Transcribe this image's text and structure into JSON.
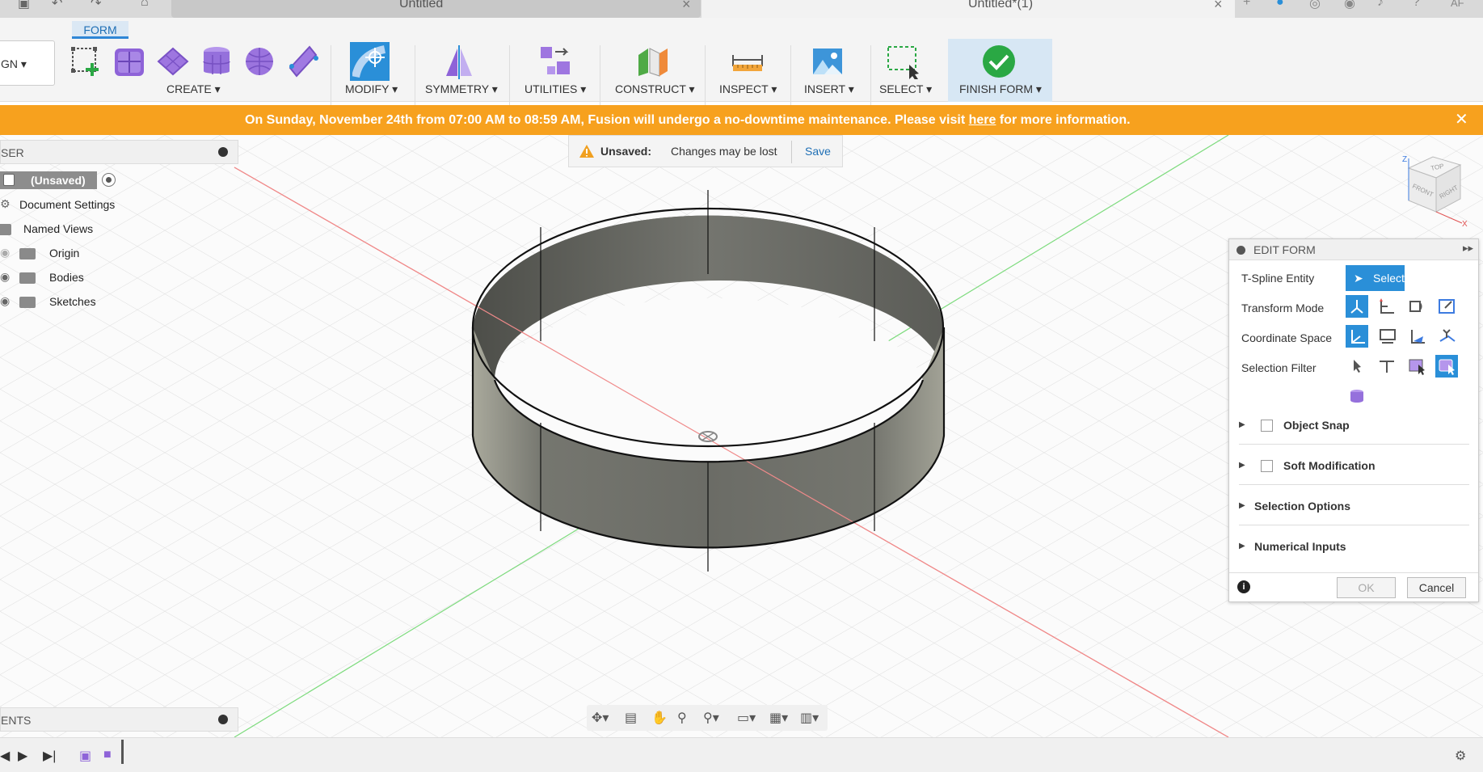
{
  "tabs": {
    "tab1_label": "Untitled",
    "tab2_label": "Untitled*(1)",
    "avatar": "AF"
  },
  "toolbar": {
    "workspace_label": "GN",
    "active_tab": "FORM",
    "groups": [
      "CREATE",
      "MODIFY",
      "SYMMETRY",
      "UTILITIES",
      "CONSTRUCT",
      "INSPECT",
      "INSERT",
      "SELECT",
      "FINISH FORM"
    ]
  },
  "banner": {
    "prefix": "On Sunday, November 24th from 07:00 AM to 08:59 AM, Fusion will undergo a no-downtime maintenance. Please visit ",
    "link": "here",
    "suffix": " for more information."
  },
  "unsaved": {
    "label": "Unsaved:",
    "message": "Changes may be lost",
    "save": "Save"
  },
  "browser": {
    "title": "SER",
    "root": "(Unsaved)",
    "items": [
      "Document Settings",
      "Named Views",
      "Origin",
      "Bodies",
      "Sketches"
    ]
  },
  "comments": {
    "title": "ENTS"
  },
  "edit_form": {
    "title": "EDIT FORM",
    "rows": [
      "T-Spline Entity",
      "Transform Mode",
      "Coordinate Space",
      "Selection Filter"
    ],
    "select_label": "Select",
    "sections": [
      "Object Snap",
      "Soft Modification",
      "Selection Options",
      "Numerical Inputs"
    ],
    "ok": "OK",
    "cancel": "Cancel"
  },
  "viewcube": {
    "top": "TOP",
    "front": "FRONT",
    "right": "RIGHT",
    "z": "Z",
    "x": "X"
  },
  "colors": {
    "accent": "#2a8fd8",
    "banner": "#f7a11e",
    "finish_bg": "#d7e7f4",
    "body": "#6f706b"
  }
}
